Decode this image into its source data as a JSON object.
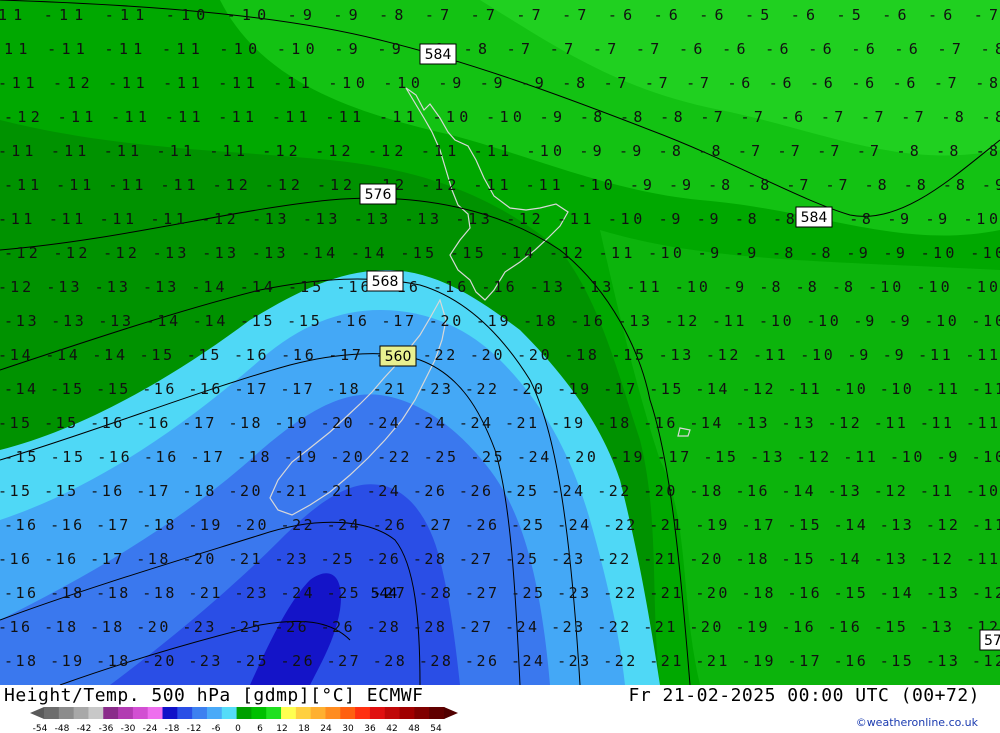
{
  "footer": {
    "title": "Height/Temp. 500 hPa [gdmp][°C] ECMWF",
    "datetime": "Fr 21-02-2025 00:00 UTC (00+72)",
    "credit": "©weatheronline.co.uk"
  },
  "legend": {
    "labels": [
      "-54",
      "-48",
      "-42",
      "-36",
      "-30",
      "-24",
      "-18",
      "-12",
      "-6",
      "0",
      "6",
      "12",
      "18",
      "24",
      "30",
      "36",
      "42",
      "48",
      "54"
    ],
    "colors": [
      "#6d6d6d",
      "#8c8c8c",
      "#a8a8a8",
      "#c8c8c8",
      "#8a2c8a",
      "#b23bb2",
      "#d24fd2",
      "#ee6eee",
      "#1010c8",
      "#2a4ee6",
      "#3d80f0",
      "#4aaaf8",
      "#55dcf8",
      "#00a000",
      "#00c000",
      "#20e020",
      "#ffff50",
      "#ffd040",
      "#ffb030",
      "#ff8c20",
      "#ff6010",
      "#ff3010",
      "#e01010",
      "#c00808",
      "#a00000",
      "#800000",
      "#600000"
    ]
  },
  "height_labels": [
    "584",
    "576",
    "568",
    "560",
    "584",
    "544",
    "57"
  ],
  "temperature_rows": [
    "11 -11 -11 -10 -10  -9   -9   -8  -7  -7  -7  -7  -6  -6  -6  -5  -6  -5  -6  -6  -7",
    "11 -11 -11 -11 -10 -10  -9   -9   -9  -8  -7  -7  -7  -7  -6  -6  -6  -6  -6  -6  -7  -8",
    "-11 -12 -11 -11 -11 -11 -10 -10  -9  -9  -9  -8  -7  -7  -7  -6  -6  -6  -6  -6  -7  -8",
    "-12 -11 -11 -11 -11 -11 -11 -11 -10 -10 -9  -8  -8  -8  -7  -7  -6  -7  -7  -7  -8  -8",
    "-11 -11 -11 -11 -11 -12 -12 -12 -11 -11 -10  -9  -9  -8  -8  -7  -7  -7  -7  -8  -8  -8",
    "-11 -11 -11 -11 -12 -12 -12 -12 -12 -11 -11 -10  -9  -9  -8  -8  -7  -7  -8  -8  -8  -9",
    "-11 -11 -11 -11 -12 -13 -13 -13 -13 -13 -12 -11 -10  -9  -9  -8  -8  -8  -8  -9  -9 -10",
    "-12 -12 -12 -13 -13 -13 -14 -14 -15 -15 -14 -12 -11 -10  -9  -9  -8  -8  -9  -9 -10 -10",
    "-12 -13 -13 -13 -14 -14 -15 -16 -16 -16 -16 -13 -13 -11 -10  -9  -8  -8  -8 -10 -10 -10",
    "-13 -13 -13 -14 -14 -15 -15 -16 -17 -20 -19 -18 -16 -13 -12 -11 -10 -10  -9  -9 -10 -10",
    "-14 -14 -14 -15 -15 -16 -16 -17 -19 -22 -20 -20 -18 -15 -13 -12 -11 -10  -9  -9 -11 -11",
    "-14 -15 -15 -16 -16 -17 -17 -18 -21 -23 -22 -20 -19 -17 -15 -14 -12 -11 -10 -10 -11 -11",
    "-15 -15 -16 -16 -17 -18 -19 -20 -24 -24 -24 -21 -19 -18 -16 -14 -13 -13 -12 -11 -11 -11",
    "-15 -15 -16 -16 -17 -18 -19 -20 -22 -25 -25 -24 -20 -19 -17 -15 -13 -12 -11 -10  -9 -10",
    "-15 -15 -16 -17 -18 -20 -21 -21 -24 -26 -26 -25 -24 -22 -20 -18 -16 -14 -13 -12 -11 -10",
    "-16 -16 -17 -18 -19 -20 -22 -24 -26 -27 -26 -25 -24 -22 -21 -19 -17 -15 -14 -13 -12 -11",
    "-16 -16 -17 -18 -20 -21 -23 -25 -26 -28 -27 -25 -23 -22 -21 -20 -18 -15 -14 -13 -12 -11",
    "-16 -18 -18 -18 -21 -23 -24 -25 -27 -28 -27 -25 -23 -22 -21 -20 -18 -16 -15 -14 -13 -12",
    "-16 -18 -18 -20 -23 -25 -26 -26 -28 -28 -27 -24 -23 -22 -21 -20 -19 -16 -16 -15 -13 -12",
    "-18 -19 -18 -20 -23 -25 -26 -27 -28 -28 -26 -24 -23 -22 -21 -21 -19 -17 -16 -15 -13 -12"
  ]
}
